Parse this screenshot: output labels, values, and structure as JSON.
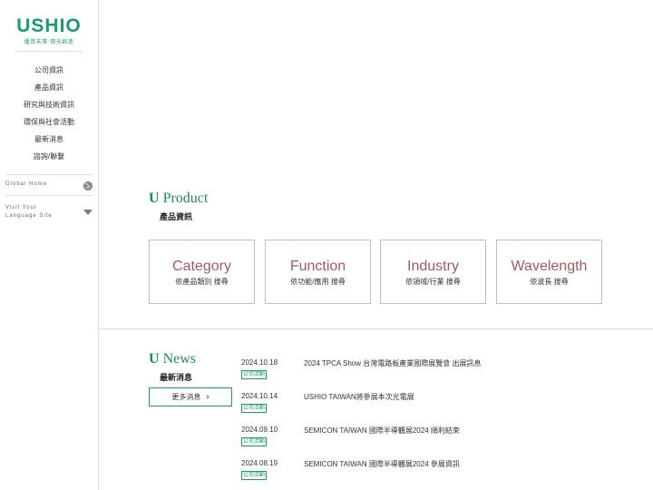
{
  "brand": {
    "name": "USHIO",
    "tagline": "優質未來‧用光創造",
    "color": "#1a9a6e"
  },
  "nav": [
    {
      "label": "公司資訊"
    },
    {
      "label": "產品資訊"
    },
    {
      "label": "研究與技術資訊"
    },
    {
      "label": "環保與社會活動"
    },
    {
      "label": "最新消息"
    },
    {
      "label": "諮詢/聯繫"
    }
  ],
  "sidebar_links": {
    "global_home": "Global Home",
    "visit_line1": "Visit Your",
    "visit_line2": "Language Site",
    "globe_icon": "globe-icon",
    "dropdown_icon": "triangle-down-icon"
  },
  "product": {
    "title_u": "U",
    "title_rest": " Product",
    "subtitle": "產品資訊",
    "cards": [
      {
        "title": "Category",
        "sub": "依產品類別 搜尋"
      },
      {
        "title": "Function",
        "sub": "依功能/應用 搜尋"
      },
      {
        "title": "Industry",
        "sub": "依領域/行業 搜尋"
      },
      {
        "title": "Wavelength",
        "sub": "依波長 搜尋"
      }
    ]
  },
  "news": {
    "title_u": "U",
    "title_rest": " News",
    "subtitle": "最新消息",
    "more_label": "更多消息",
    "items": [
      {
        "date": "2024.10.18",
        "tag": "公司活動",
        "text": "2024 TPCA Show 台灣電路板產業國際展覽會 出展訊息"
      },
      {
        "date": "2024.10.14",
        "tag": "公司活動",
        "text": "USHIO TAIWAN將參展本次光電展"
      },
      {
        "date": "2024.09.10",
        "tag": "公司活動",
        "text": "SEMICON TAIWAN 國際半導體展2024 順利結束"
      },
      {
        "date": "2024.08.19",
        "tag": "公司活動",
        "text": "SEMICON TAIWAN 國際半導體展2024 參展資訊"
      }
    ]
  }
}
